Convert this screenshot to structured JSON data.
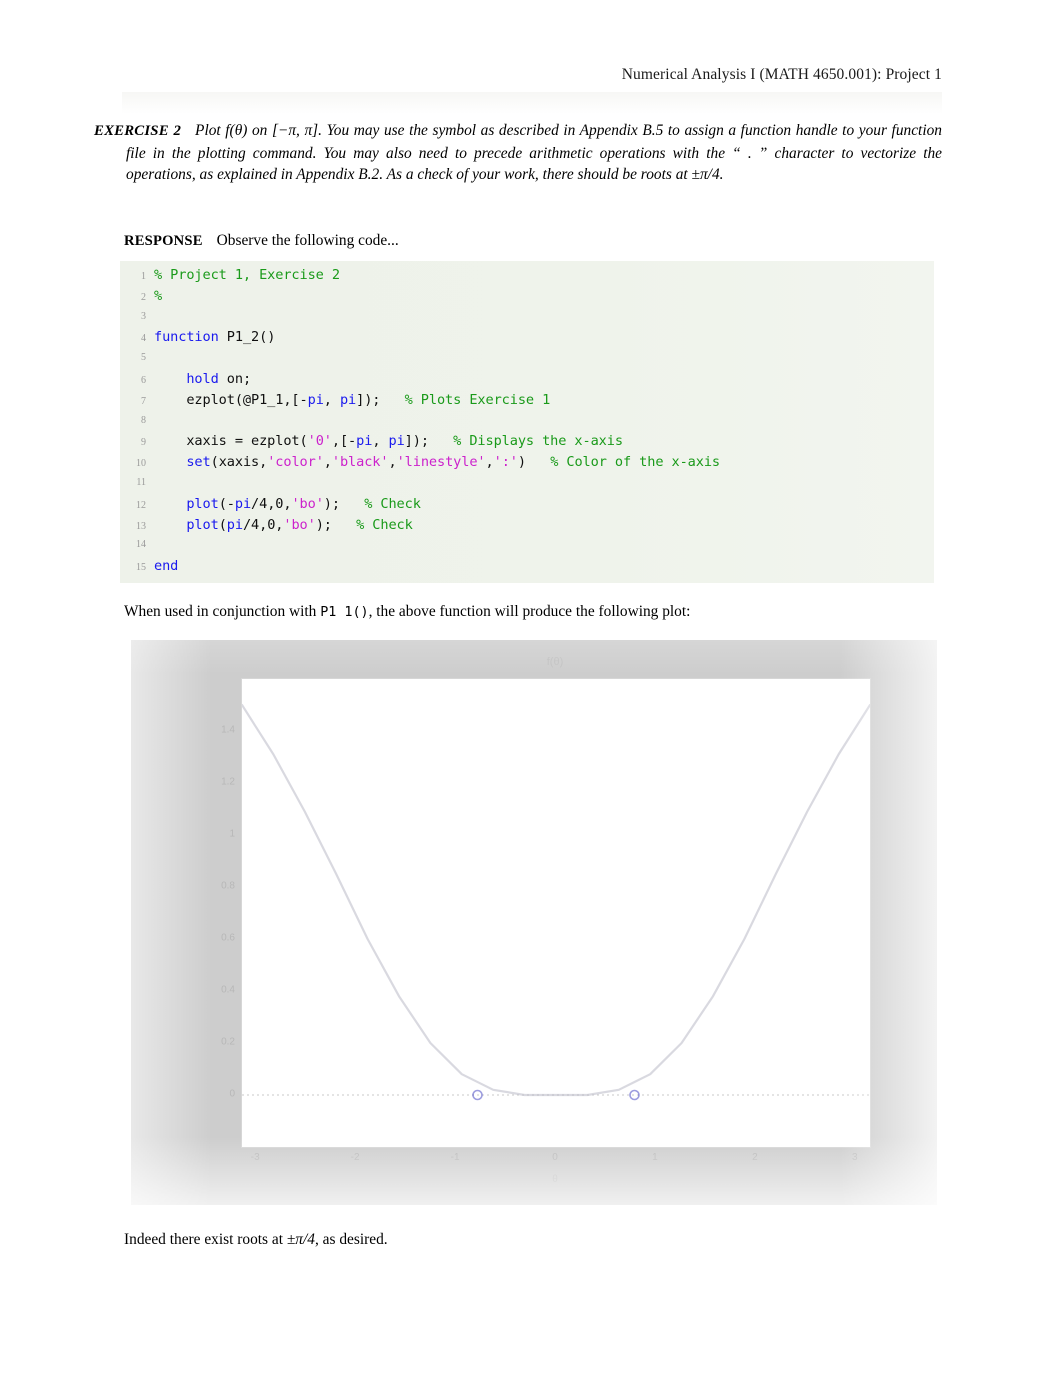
{
  "header": {
    "running_title": "Numerical Analysis I (MATH 4650.001): Project 1"
  },
  "exercise": {
    "label": "EXERCISE 2",
    "text": "Plot f(θ) on [−π, π]. You may use the symbol as described in Appendix B.5 to assign a function handle to your function file in the plotting command. You may also need to precede arithmetic operations with the “ . ” character to vectorize the operations, as explained in Appendix B.2. As a check of your work, there should be roots at ±π/4."
  },
  "response": {
    "label": "RESPONSE",
    "text": "Observe the following code..."
  },
  "code": {
    "language": "matlab",
    "colors": {
      "comment": "#1a9a1a",
      "keyword": "#1a1aee",
      "string": "#cc22cc",
      "plain": "#101010",
      "background": "#eff3eb",
      "linenumber": "#9a9a9a"
    },
    "lines": [
      {
        "n": "1",
        "tokens": [
          {
            "t": "% Project 1, Exercise 2",
            "c": "cmt"
          }
        ]
      },
      {
        "n": "2",
        "tokens": [
          {
            "t": "%",
            "c": "cmt"
          }
        ]
      },
      {
        "n": "3",
        "tokens": [
          {
            "t": "",
            "c": "pln"
          }
        ]
      },
      {
        "n": "4",
        "tokens": [
          {
            "t": "function",
            "c": "kw"
          },
          {
            "t": " P1_2()",
            "c": "pln"
          }
        ]
      },
      {
        "n": "5",
        "tokens": [
          {
            "t": "",
            "c": "pln"
          }
        ]
      },
      {
        "n": "6",
        "tokens": [
          {
            "t": "    ",
            "c": "pln"
          },
          {
            "t": "hold",
            "c": "kw"
          },
          {
            "t": " on;",
            "c": "pln"
          }
        ]
      },
      {
        "n": "7",
        "tokens": [
          {
            "t": "    ezplot(@P1_1,[-",
            "c": "pln"
          },
          {
            "t": "pi",
            "c": "kw"
          },
          {
            "t": ", ",
            "c": "pln"
          },
          {
            "t": "pi",
            "c": "kw"
          },
          {
            "t": "]);   ",
            "c": "pln"
          },
          {
            "t": "% Plots Exercise 1",
            "c": "cmt"
          }
        ]
      },
      {
        "n": "8",
        "tokens": [
          {
            "t": "",
            "c": "pln"
          }
        ]
      },
      {
        "n": "9",
        "tokens": [
          {
            "t": "    xaxis = ezplot(",
            "c": "pln"
          },
          {
            "t": "'0'",
            "c": "str"
          },
          {
            "t": ",[-",
            "c": "pln"
          },
          {
            "t": "pi",
            "c": "kw"
          },
          {
            "t": ", ",
            "c": "pln"
          },
          {
            "t": "pi",
            "c": "kw"
          },
          {
            "t": "]);   ",
            "c": "pln"
          },
          {
            "t": "% Displays the x-axis",
            "c": "cmt"
          }
        ]
      },
      {
        "n": "10",
        "tokens": [
          {
            "t": "    ",
            "c": "pln"
          },
          {
            "t": "set",
            "c": "kw"
          },
          {
            "t": "(xaxis,",
            "c": "pln"
          },
          {
            "t": "'color'",
            "c": "str"
          },
          {
            "t": ",",
            "c": "pln"
          },
          {
            "t": "'black'",
            "c": "str"
          },
          {
            "t": ",",
            "c": "pln"
          },
          {
            "t": "'linestyle'",
            "c": "str"
          },
          {
            "t": ",",
            "c": "pln"
          },
          {
            "t": "':'",
            "c": "str"
          },
          {
            "t": ")   ",
            "c": "pln"
          },
          {
            "t": "% Color of the x-axis",
            "c": "cmt"
          }
        ]
      },
      {
        "n": "11",
        "tokens": [
          {
            "t": "",
            "c": "pln"
          }
        ]
      },
      {
        "n": "12",
        "tokens": [
          {
            "t": "    ",
            "c": "pln"
          },
          {
            "t": "plot",
            "c": "kw"
          },
          {
            "t": "(-",
            "c": "pln"
          },
          {
            "t": "pi",
            "c": "kw"
          },
          {
            "t": "/4,0,",
            "c": "pln"
          },
          {
            "t": "'bo'",
            "c": "str"
          },
          {
            "t": ");   ",
            "c": "pln"
          },
          {
            "t": "% Check",
            "c": "cmt"
          }
        ]
      },
      {
        "n": "13",
        "tokens": [
          {
            "t": "    ",
            "c": "pln"
          },
          {
            "t": "plot",
            "c": "kw"
          },
          {
            "t": "(",
            "c": "pln"
          },
          {
            "t": "pi",
            "c": "kw"
          },
          {
            "t": "/4,0,",
            "c": "pln"
          },
          {
            "t": "'bo'",
            "c": "str"
          },
          {
            "t": ");   ",
            "c": "pln"
          },
          {
            "t": "% Check",
            "c": "cmt"
          }
        ]
      },
      {
        "n": "14",
        "tokens": [
          {
            "t": "",
            "c": "pln"
          }
        ]
      },
      {
        "n": "15",
        "tokens": [
          {
            "t": "end",
            "c": "kw"
          }
        ]
      }
    ]
  },
  "mid_paragraph": {
    "before_code": "When used in conjunction with ",
    "code_ref": "P1 1()",
    "after_code": ", the above function will produce the following plot:"
  },
  "figure": {
    "caption_note": "MATLAB figure window showing plot of f(theta) over [-pi, pi]",
    "background_color": "#cdcdcd",
    "axes_background": "#ffffff",
    "marker_color": "#3a3ac0"
  },
  "end_paragraph": {
    "text_before": "Indeed there exist roots at ",
    "math": "±π/4",
    "text_after": ", as desired."
  },
  "chart_data": {
    "type": "line",
    "title": "f(θ)",
    "xlabel": "θ",
    "ylabel": "",
    "xlim": [
      -3.1416,
      3.1416
    ],
    "ylim": [
      -0.2,
      1.6
    ],
    "xticks": [
      -3,
      -2,
      -1,
      0,
      1,
      2,
      3
    ],
    "xticklabels": [
      "-3",
      "-2",
      "-1",
      "0",
      "1",
      "2",
      "3"
    ],
    "yticks": [
      0,
      0.2,
      0.4,
      0.6,
      0.8,
      1.0,
      1.2,
      1.4
    ],
    "yticklabels": [
      "0",
      "0.2",
      "0.4",
      "0.6",
      "0.8",
      "1",
      "1.2",
      "1.4"
    ],
    "grid": false,
    "legend": null,
    "series": [
      {
        "name": "f(theta)",
        "style": "solid",
        "color": "#b9b9c6",
        "x": [
          -3.1416,
          -2.8274,
          -2.5133,
          -2.1991,
          -1.885,
          -1.5708,
          -1.2566,
          -0.9425,
          -0.6283,
          -0.3142,
          0.0,
          0.3142,
          0.6283,
          0.9425,
          1.2566,
          1.5708,
          1.885,
          2.1991,
          2.5133,
          2.8274,
          3.1416
        ],
        "y": [
          1.5,
          1.31,
          1.09,
          0.85,
          0.6,
          0.38,
          0.2,
          0.08,
          0.02,
          0.0,
          0.0,
          0.0,
          0.02,
          0.08,
          0.2,
          0.38,
          0.6,
          0.85,
          1.09,
          1.31,
          1.5
        ]
      },
      {
        "name": "x-axis",
        "style": "dotted",
        "color": "#000000",
        "x": [
          -3.1416,
          3.1416
        ],
        "y": [
          0,
          0
        ]
      },
      {
        "name": "roots check markers",
        "style": "markers",
        "marker": "o",
        "color": "#3a3ac0",
        "x": [
          -0.7854,
          0.7854
        ],
        "y": [
          0,
          0
        ]
      }
    ]
  }
}
